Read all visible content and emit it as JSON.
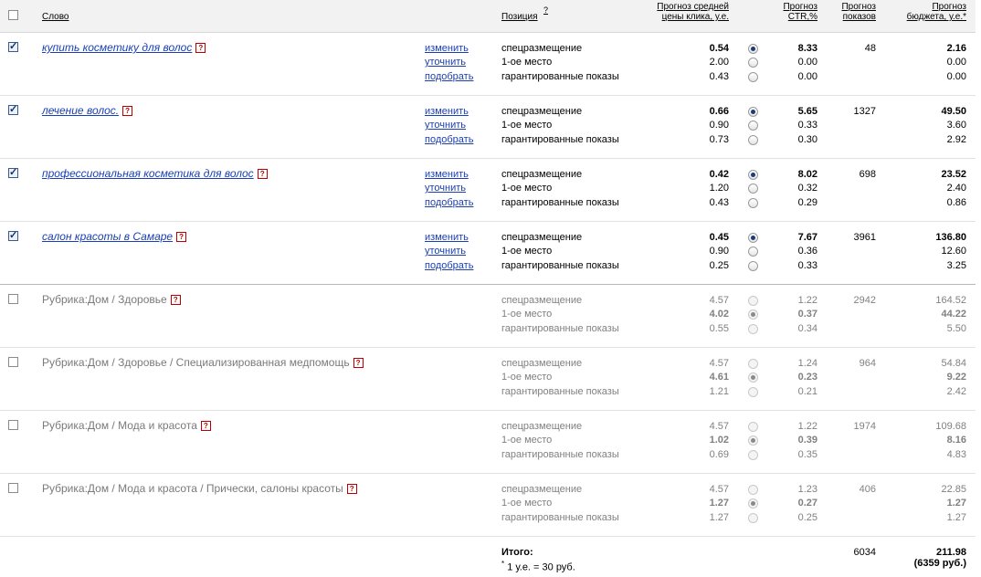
{
  "header": {
    "word": "Слово",
    "position": "Позиция",
    "position_sup": "?",
    "avg_price_l1": "Прогноз средней",
    "avg_price_l2": "цены клика, у.е.",
    "ctr_l1": "Прогноз",
    "ctr_l2": "CTR,%",
    "shows_l1": "Прогноз",
    "shows_l2": "показов",
    "budget_l1": "Прогноз",
    "budget_l2": "бюджета, у.е.*"
  },
  "actions": {
    "change": "изменить",
    "refine": "уточнить",
    "pick": "подобрать"
  },
  "positions": [
    "спецразмещение",
    "1-ое место",
    "гарантированные показы"
  ],
  "question_icon": "?",
  "rows": [
    {
      "keyword": "купить косметику для волос",
      "checked": true,
      "type": "keyword",
      "prices": [
        "0.54",
        "2.00",
        "0.43"
      ],
      "ctr": [
        "8.33",
        "0.00",
        "0.00"
      ],
      "shows": "48",
      "budget": [
        "2.16",
        "0.00",
        "0.00"
      ],
      "selected": 0
    },
    {
      "keyword": "лечение волос.",
      "checked": true,
      "type": "keyword",
      "prices": [
        "0.66",
        "0.90",
        "0.73"
      ],
      "ctr": [
        "5.65",
        "0.33",
        "0.30"
      ],
      "shows": "1327",
      "budget": [
        "49.50",
        "3.60",
        "2.92"
      ],
      "selected": 0
    },
    {
      "keyword": "профессиональная косметика для волос",
      "checked": true,
      "type": "keyword",
      "prices": [
        "0.42",
        "1.20",
        "0.43"
      ],
      "ctr": [
        "8.02",
        "0.32",
        "0.29"
      ],
      "shows": "698",
      "budget": [
        "23.52",
        "2.40",
        "0.86"
      ],
      "selected": 0
    },
    {
      "keyword": "салон красоты в Самаре",
      "checked": true,
      "type": "keyword",
      "prices": [
        "0.45",
        "0.90",
        "0.25"
      ],
      "ctr": [
        "7.67",
        "0.36",
        "0.33"
      ],
      "shows": "3961",
      "budget": [
        "136.80",
        "12.60",
        "3.25"
      ],
      "selected": 0
    },
    {
      "keyword": "Рубрика:Дом / Здоровье",
      "checked": false,
      "type": "rubric",
      "prices": [
        "4.57",
        "4.02",
        "0.55"
      ],
      "ctr": [
        "1.22",
        "0.37",
        "0.34"
      ],
      "shows": "2942",
      "budget": [
        "164.52",
        "44.22",
        "5.50"
      ],
      "selected": 1
    },
    {
      "keyword": "Рубрика:Дом / Здоровье / Специализированная медпомощь",
      "checked": false,
      "type": "rubric",
      "prices": [
        "4.57",
        "4.61",
        "1.21"
      ],
      "ctr": [
        "1.24",
        "0.23",
        "0.21"
      ],
      "shows": "964",
      "budget": [
        "54.84",
        "9.22",
        "2.42"
      ],
      "selected": 1
    },
    {
      "keyword": "Рубрика:Дом / Мода и красота",
      "checked": false,
      "type": "rubric",
      "prices": [
        "4.57",
        "1.02",
        "0.69"
      ],
      "ctr": [
        "1.22",
        "0.39",
        "0.35"
      ],
      "shows": "1974",
      "budget": [
        "109.68",
        "8.16",
        "4.83"
      ],
      "selected": 1
    },
    {
      "keyword": "Рубрика:Дом / Мода и красота / Прически, салоны красоты",
      "checked": false,
      "type": "rubric",
      "prices": [
        "4.57",
        "1.27",
        "1.27"
      ],
      "ctr": [
        "1.23",
        "0.27",
        "0.25"
      ],
      "shows": "406",
      "budget": [
        "22.85",
        "1.27",
        "1.27"
      ],
      "selected": 1
    }
  ],
  "totals": {
    "label": "Итого:",
    "footnote_mark": "*",
    "footnote": "1 у.е. = 30 руб.",
    "shows": "6034",
    "budget": "211.98",
    "budget_rub": "(6359 руб.)"
  }
}
